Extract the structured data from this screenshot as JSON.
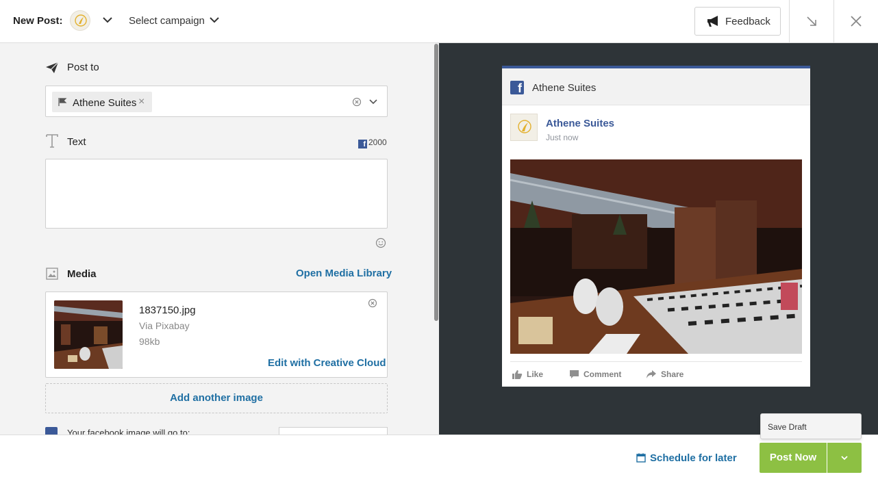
{
  "topbar": {
    "title": "New Post:",
    "campaign": "Select campaign",
    "feedback": "Feedback"
  },
  "postto": {
    "label": "Post to",
    "chip": "Athene Suites",
    "chip_remove": "×"
  },
  "text": {
    "label": "Text",
    "char_limit": "2000",
    "fb_glyph": "f"
  },
  "media": {
    "label": "Media",
    "open_library": "Open Media Library",
    "file_name": "1837150.jpg",
    "source": "Via Pixabay",
    "size": "98kb",
    "edit": "Edit with Creative Cloud",
    "add_another": "Add another image"
  },
  "facebook_dest": {
    "text": "Your facebook image will go to:"
  },
  "preview": {
    "header_page": "Athene Suites",
    "fb_glyph": "f",
    "author": "Athene Suites",
    "time": "Just now",
    "actions": [
      "Like",
      "Comment",
      "Share"
    ]
  },
  "bottom": {
    "schedule": "Schedule for later",
    "post_now": "Post Now",
    "save_draft": "Save Draft"
  },
  "colors": {
    "accent_green": "#8dc043",
    "link_blue": "#1f6fa3",
    "facebook_blue": "#3b5998",
    "preview_bg": "#2e3438"
  }
}
